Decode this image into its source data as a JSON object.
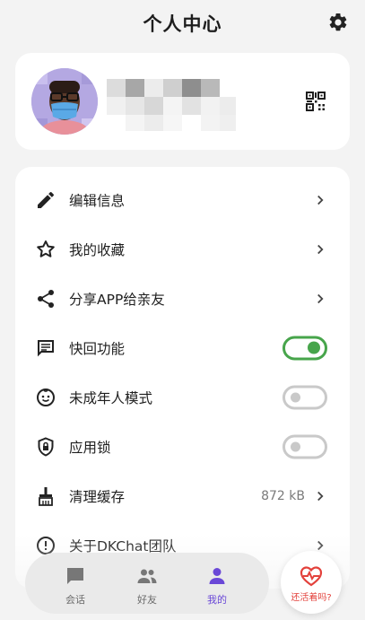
{
  "header": {
    "title": "个人中心",
    "settings_icon": "gear-icon"
  },
  "profile": {
    "avatar_icon": "avatar-icon",
    "qr_icon": "qr-code-icon"
  },
  "menu": {
    "items": [
      {
        "label": "编辑信息",
        "icon": "pencil-icon",
        "control": "chevron"
      },
      {
        "label": "我的收藏",
        "icon": "star-icon",
        "control": "chevron"
      },
      {
        "label": "分享APP给亲友",
        "icon": "share-icon",
        "control": "chevron"
      },
      {
        "label": "快回功能",
        "icon": "message-icon",
        "control": "toggle",
        "on": true
      },
      {
        "label": "未成年人模式",
        "icon": "child-face-icon",
        "control": "toggle",
        "on": false
      },
      {
        "label": "应用锁",
        "icon": "lock-shield-icon",
        "control": "toggle",
        "on": false
      },
      {
        "label": "清理缓存",
        "icon": "broom-icon",
        "control": "chevron",
        "value": "872 kB"
      },
      {
        "label": "关于DKChat团队",
        "icon": "info-icon",
        "control": "chevron"
      }
    ]
  },
  "nav": {
    "tabs": [
      {
        "label": "会话",
        "icon": "chat-bubble-icon",
        "active": false
      },
      {
        "label": "好友",
        "icon": "friends-icon",
        "active": false
      },
      {
        "label": "我的",
        "icon": "person-icon",
        "active": true
      }
    ]
  },
  "fab": {
    "label": "还活着吗?",
    "icon": "heartbeat-icon"
  },
  "colors": {
    "accent": "#6a48d7",
    "toggle_on": "#47a54b",
    "alert": "#e3413b",
    "background": "#f3f3f3"
  }
}
